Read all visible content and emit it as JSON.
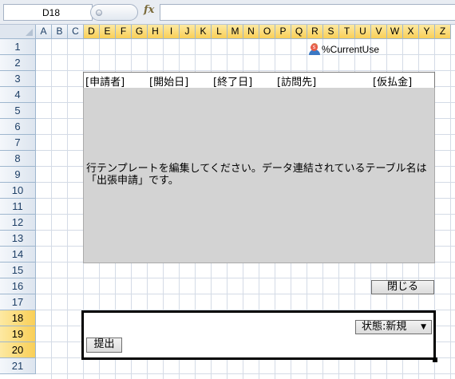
{
  "formula_bar": {
    "cell_reference": "D18",
    "fx_label": "fx",
    "formula": ""
  },
  "columns": [
    "A",
    "B",
    "C",
    "D",
    "E",
    "F",
    "G",
    "H",
    "I",
    "J",
    "K",
    "L",
    "M",
    "N",
    "O",
    "P",
    "Q",
    "R",
    "S",
    "T",
    "U",
    "V",
    "W",
    "X",
    "Y",
    "Z"
  ],
  "selected_columns": [
    "D",
    "E",
    "F",
    "G",
    "H",
    "I",
    "J",
    "K",
    "L",
    "M",
    "N",
    "O",
    "P",
    "Q",
    "R",
    "S",
    "T",
    "U",
    "V",
    "W",
    "X",
    "Y",
    "Z"
  ],
  "rows": [
    "1",
    "2",
    "3",
    "4",
    "5",
    "6",
    "7",
    "8",
    "9",
    "10",
    "11",
    "12",
    "13",
    "14",
    "15",
    "16",
    "17",
    "18",
    "19",
    "20",
    "21"
  ],
  "selected_rows": [
    "18",
    "19",
    "20"
  ],
  "user_cell": {
    "icon": "user-icon",
    "text": "%CurrentUse"
  },
  "template_header": [
    "[申請者]",
    "[開始日]",
    "[終了日]",
    "[訪問先]",
    "[仮払金]"
  ],
  "template_message": [
    "行テンプレートを編集してください。データ連結されているテーブル名は",
    "「出張申請」です。"
  ],
  "close_button": "閉じる",
  "form": {
    "status_label": "状態:新規",
    "status_arrow": "▼",
    "submit_button": "提出"
  },
  "colors": {
    "template_bg": "#d3d3d3",
    "selected_header": "#f9cf57",
    "header_text": "#1e3f66",
    "grid_line": "#d4dbe6"
  }
}
